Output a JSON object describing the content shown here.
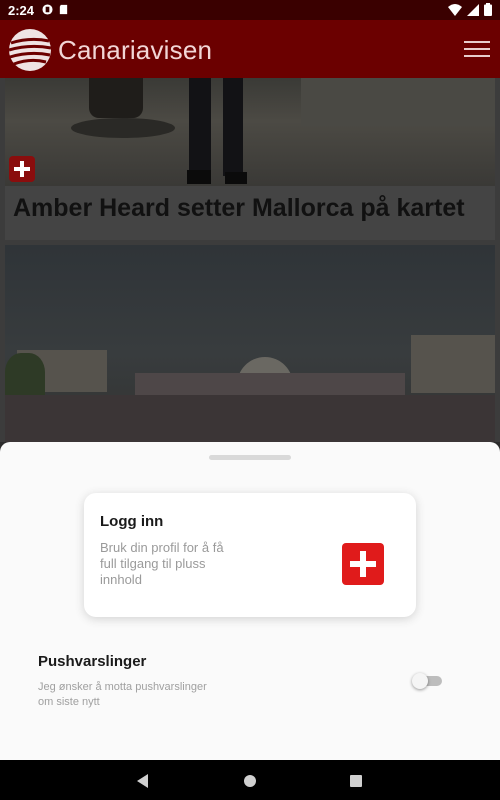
{
  "status_bar": {
    "time": "2:24",
    "left_icons": [
      "browser-icon",
      "sd-card-icon"
    ],
    "right_icons": [
      "wifi-icon",
      "signal-icon",
      "battery-icon"
    ]
  },
  "app_bar": {
    "title": "Canariavisen",
    "brand_color": "#6b0000",
    "logo": "globe-logo-icon",
    "menu_icon": "hamburger-menu-icon"
  },
  "feed": {
    "articles": [
      {
        "headline": "Amber Heard setter Mallorca på kartet",
        "badge": "plus-badge-icon"
      },
      {
        "headline": ""
      }
    ]
  },
  "bottom_sheet": {
    "login": {
      "title": "Logg inn",
      "description": "Bruk din profil for å få full tilgang til pluss innhold",
      "icon": "plus-cross-icon",
      "icon_color": "#e01b1b"
    },
    "push": {
      "title": "Pushvarslinger",
      "description": "Jeg ønsker å motta pushvarslinger om siste nytt",
      "enabled": false
    }
  },
  "nav_bar": {
    "buttons": [
      "back-icon",
      "home-icon",
      "recents-icon"
    ]
  }
}
